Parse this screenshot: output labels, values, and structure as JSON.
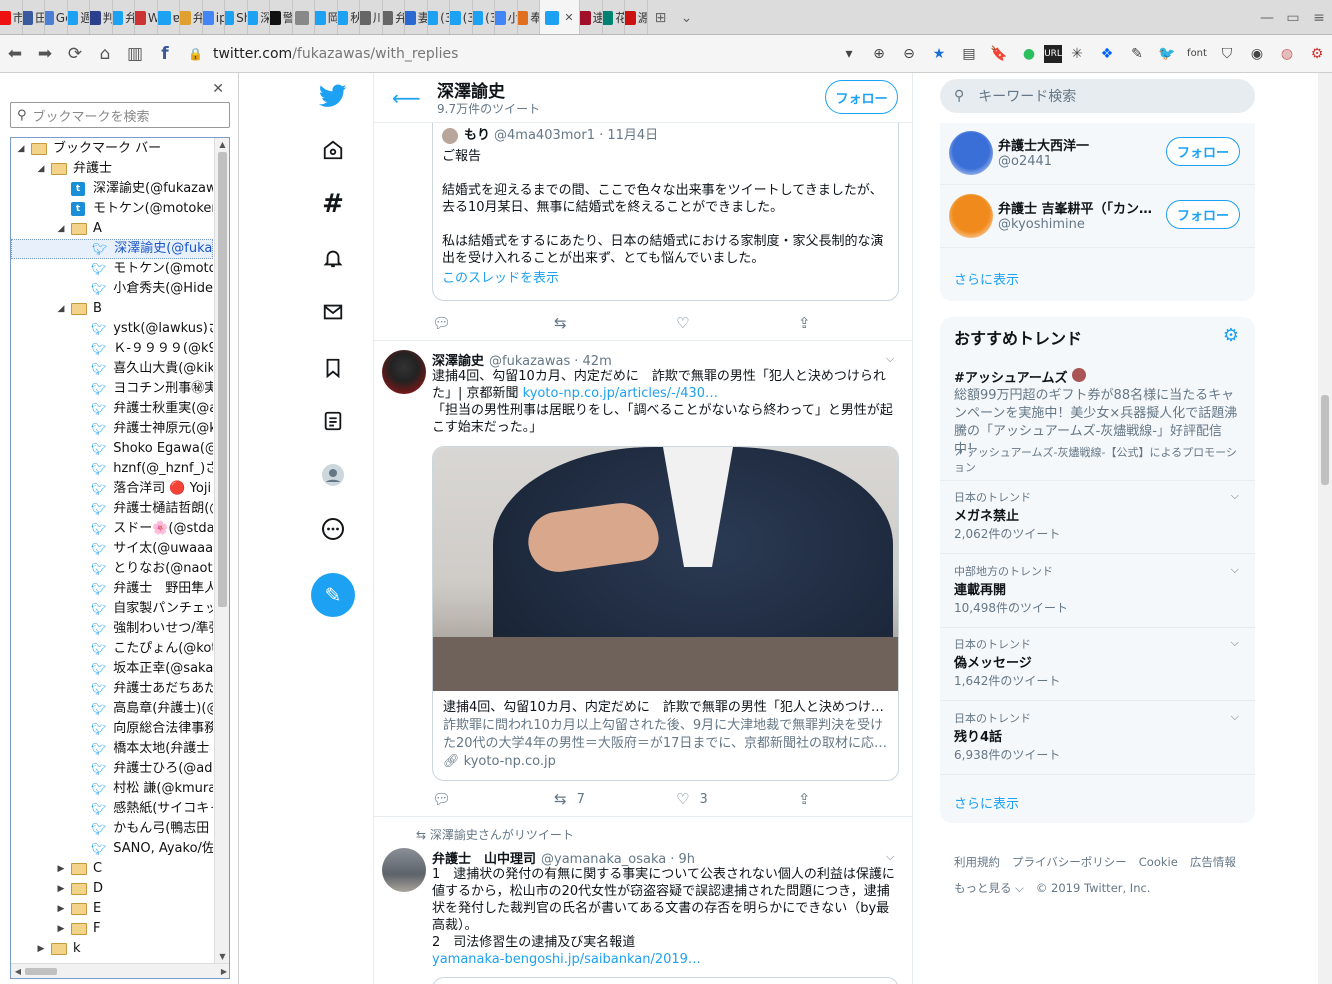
{
  "browser": {
    "tabs": [
      {
        "label": "市",
        "color": "#e11"
      },
      {
        "label": "田",
        "color": "#3a5aa0"
      },
      {
        "label": "Gc",
        "color": "#4a7fd4"
      },
      {
        "label": "週",
        "color": "#1da1f2"
      },
      {
        "label": "判",
        "color": "#2b3f8c"
      },
      {
        "label": "弁",
        "color": "#1da1f2"
      },
      {
        "label": "W",
        "color": "#c33"
      },
      {
        "label": "ɐ",
        "color": "#1da1f2"
      },
      {
        "label": "弁",
        "color": "#e0a030"
      },
      {
        "label": "ip",
        "color": "#4285f4"
      },
      {
        "label": "Sh",
        "color": "#1da1f2"
      },
      {
        "label": "深",
        "color": "#1da1f2"
      },
      {
        "label": "警",
        "color": "#111"
      },
      {
        "label": "",
        "color": "#888"
      },
      {
        "label": "岡",
        "color": "#1da1f2"
      },
      {
        "label": "秋",
        "color": "#1da1f2"
      },
      {
        "label": "川",
        "color": "#666"
      },
      {
        "label": "弁",
        "color": "#666"
      },
      {
        "label": "妻",
        "color": "#2a6ad0"
      },
      {
        "label": "(3",
        "color": "#1da1f2"
      },
      {
        "label": "(3",
        "color": "#1da1f2"
      },
      {
        "label": "(3",
        "color": "#1da1f2"
      },
      {
        "label": "小",
        "color": "#4285f4"
      },
      {
        "label": "奉",
        "color": "#e07020"
      }
    ],
    "active_tab": {
      "label": "",
      "color": "#1da1f2"
    },
    "tabs_after": [
      {
        "label": "逮",
        "color": "#a0102a"
      },
      {
        "label": "花",
        "color": "#008272"
      },
      {
        "label": "源",
        "color": "#c11"
      }
    ],
    "url_host": "twitter.com",
    "url_path": "/fukazawas/with_replies"
  },
  "bookmarks": {
    "search_placeholder": "ブックマークを検索",
    "tree": [
      {
        "depth": 0,
        "type": "folder",
        "open": true,
        "label": "ブックマーク バー"
      },
      {
        "depth": 1,
        "type": "folder",
        "open": true,
        "label": "弁護士"
      },
      {
        "depth": 2,
        "type": "tw",
        "label": "深澤諭史(@fukazawas"
      },
      {
        "depth": 2,
        "type": "tw",
        "label": "モトケン(@motoken_"
      },
      {
        "depth": 2,
        "type": "folder",
        "open": true,
        "label": "A"
      },
      {
        "depth": 3,
        "type": "bird",
        "label": "深澤諭史(@fukaz",
        "selected": true
      },
      {
        "depth": 3,
        "type": "bird",
        "label": "モトケン(@motok"
      },
      {
        "depth": 3,
        "type": "bird",
        "label": "小倉秀夫(@Hide"
      },
      {
        "depth": 2,
        "type": "folder",
        "open": true,
        "label": "B"
      },
      {
        "depth": 3,
        "type": "bird",
        "label": "ystk(@lawkus)さん"
      },
      {
        "depth": 3,
        "type": "bird",
        "label": "Ｋ-９９９９(@k99"
      },
      {
        "depth": 3,
        "type": "bird",
        "label": "喜久山大貴(@kik"
      },
      {
        "depth": 3,
        "type": "bird",
        "label": "ヨコチン刑事㊙実"
      },
      {
        "depth": 3,
        "type": "bird",
        "label": "弁護士秋重実(@a"
      },
      {
        "depth": 3,
        "type": "bird",
        "label": "弁護士神原元(@k"
      },
      {
        "depth": 3,
        "type": "bird",
        "label": "Shoko Egawa(@"
      },
      {
        "depth": 3,
        "type": "bird",
        "label": "hznf(@_hznf_)さん"
      },
      {
        "depth": 3,
        "type": "bird",
        "label": "落合洋司 🔴 Yoji O"
      },
      {
        "depth": 3,
        "type": "bird",
        "label": "弁護士樋詰哲朗(@"
      },
      {
        "depth": 3,
        "type": "bird",
        "label": "スドー🌸(@stdau"
      },
      {
        "depth": 3,
        "type": "bird",
        "label": "サイ太(@uwaaaa)"
      },
      {
        "depth": 3,
        "type": "bird",
        "label": "とりなお(@naotar"
      },
      {
        "depth": 3,
        "type": "bird",
        "label": "弁護士　野田隼人"
      },
      {
        "depth": 3,
        "type": "bird",
        "label": "自家製パンチェッタ"
      },
      {
        "depth": 3,
        "type": "bird",
        "label": "強制わいせつ/準強"
      },
      {
        "depth": 3,
        "type": "bird",
        "label": "こたぴょん(@kotac"
      },
      {
        "depth": 3,
        "type": "bird",
        "label": "坂本正幸(@sakan"
      },
      {
        "depth": 3,
        "type": "bird",
        "label": "弁護士あだちあだ"
      },
      {
        "depth": 3,
        "type": "bird",
        "label": "高島章(弁護士)(@"
      },
      {
        "depth": 3,
        "type": "bird",
        "label": "向原総合法律事務"
      },
      {
        "depth": 3,
        "type": "bird",
        "label": "橋本太地(弁護士"
      },
      {
        "depth": 3,
        "type": "bird",
        "label": "弁護士ひろ(@adv"
      },
      {
        "depth": 3,
        "type": "bird",
        "label": "村松 謙(@kmuran"
      },
      {
        "depth": 3,
        "type": "bird",
        "label": "感熱紙(サイコキャ"
      },
      {
        "depth": 3,
        "type": "bird",
        "label": "かもん弓(鴨志田"
      },
      {
        "depth": 3,
        "type": "bird",
        "label": "SANO, Ayako/佐"
      },
      {
        "depth": 2,
        "type": "folder",
        "open": false,
        "label": "C"
      },
      {
        "depth": 2,
        "type": "folder",
        "open": false,
        "label": "D"
      },
      {
        "depth": 2,
        "type": "folder",
        "open": false,
        "label": "E"
      },
      {
        "depth": 2,
        "type": "folder",
        "open": false,
        "label": "F"
      },
      {
        "depth": 1,
        "type": "folder",
        "open": false,
        "label": "k"
      }
    ]
  },
  "header": {
    "name": "深澤諭史",
    "tweet_count": "9.7万件のツイート",
    "follow_label": "フォロー"
  },
  "quote": {
    "name": "もり",
    "handle": "@4ma403mor1 · 11月4日",
    "lines": [
      "ご報告",
      "",
      "結婚式を迎えるまでの間、ここで色々な出来事をツイートしてきましたが、去る10月某日、無事に結婚式を終えることができました。",
      "",
      "私は結婚式をするにあたり、日本の結婚式における家制度・家父長制的な演出を受け入れることが出来ず、とても悩んでいました。"
    ],
    "show_thread": "このスレッドを表示"
  },
  "tweet1": {
    "name": "深澤諭史",
    "handle": "@fukazawas",
    "time": "· 42m",
    "text_a": "逮捕4回、勾留10カ月、内定だめに　詐欺で無罪の男性「犯人と決めつけられた」| 京都新聞 ",
    "link": "kyoto-np.co.jp/articles/-/430…",
    "text_b": "「担当の男性刑事は居眠りをし、「調べることがないなら終わって」と男性が起こす始末だった。」",
    "card_title": "逮捕4回、勾留10カ月、内定だめに　詐欺で無罪の男性「犯人と決めつけら…",
    "card_desc": "詐欺罪に問われ10カ月以上勾留された後、9月に大津地裁で無罪判決を受けた20代の大学4年の男性＝大阪府＝が17日までに、京都新聞社の取材に応…",
    "card_domain": "kyoto-np.co.jp",
    "retweets": "7",
    "likes": "3"
  },
  "retweet_label": "深澤諭史さんがリツイート",
  "tweet2": {
    "name": "弁護士　山中理司",
    "handle": "@yamanaka_osaka",
    "time": "· 9h",
    "text": "1　逮捕状の発付の有無に関する事実について公表されない個人の利益は保護に値するから，松山市の20代女性が窃盗容疑で誤認逮捕された問題につき，逮捕状を発付した裁判官の氏名が書いてある文書の存否を明らかにできない（by最高裁）。\n2　司法修習生の逮捕及び実名報道",
    "link": "yamanaka-bengoshi.jp/saibankan/2019…"
  },
  "right": {
    "search_placeholder": "キーワード検索",
    "who_to_follow": [
      {
        "name": "弁護士大西洋一",
        "handle": "@o2441",
        "follow": "フォロー",
        "color": "#3a6fd8"
      },
      {
        "name": "弁護士 吉峯耕平（｢カン…",
        "handle": "@kyoshimine",
        "follow": "フォロー",
        "color": "#f08a1c"
      }
    ],
    "show_more": "さらに表示",
    "trends_title": "おすすめトレンド",
    "promoted": {
      "name": "#アッシュアームズ",
      "desc": "総額99万円超のギフト券が88名様に当たるキャンペーンを実施中！美少女×兵器擬人化で話題沸騰の「アッシュアームズ-灰燼戦線-」好評配信中！",
      "by": "アッシュアームズ-灰燼戦線-【公式】によるプロモーション"
    },
    "trends": [
      {
        "context": "日本のトレンド",
        "name": "メガネ禁止",
        "count": "2,062件のツイート"
      },
      {
        "context": "中部地方のトレンド",
        "name": "連載再開",
        "count": "10,498件のツイート"
      },
      {
        "context": "日本のトレンド",
        "name": "偽メッセージ",
        "count": "1,642件のツイート"
      },
      {
        "context": "日本のトレンド",
        "name": "残り4話",
        "count": "6,938件のツイート"
      }
    ],
    "footer": [
      "利用規約",
      "プライバシーポリシー",
      "Cookie",
      "広告情報",
      "もっと見る ⌵",
      "© 2019 Twitter, Inc."
    ]
  }
}
